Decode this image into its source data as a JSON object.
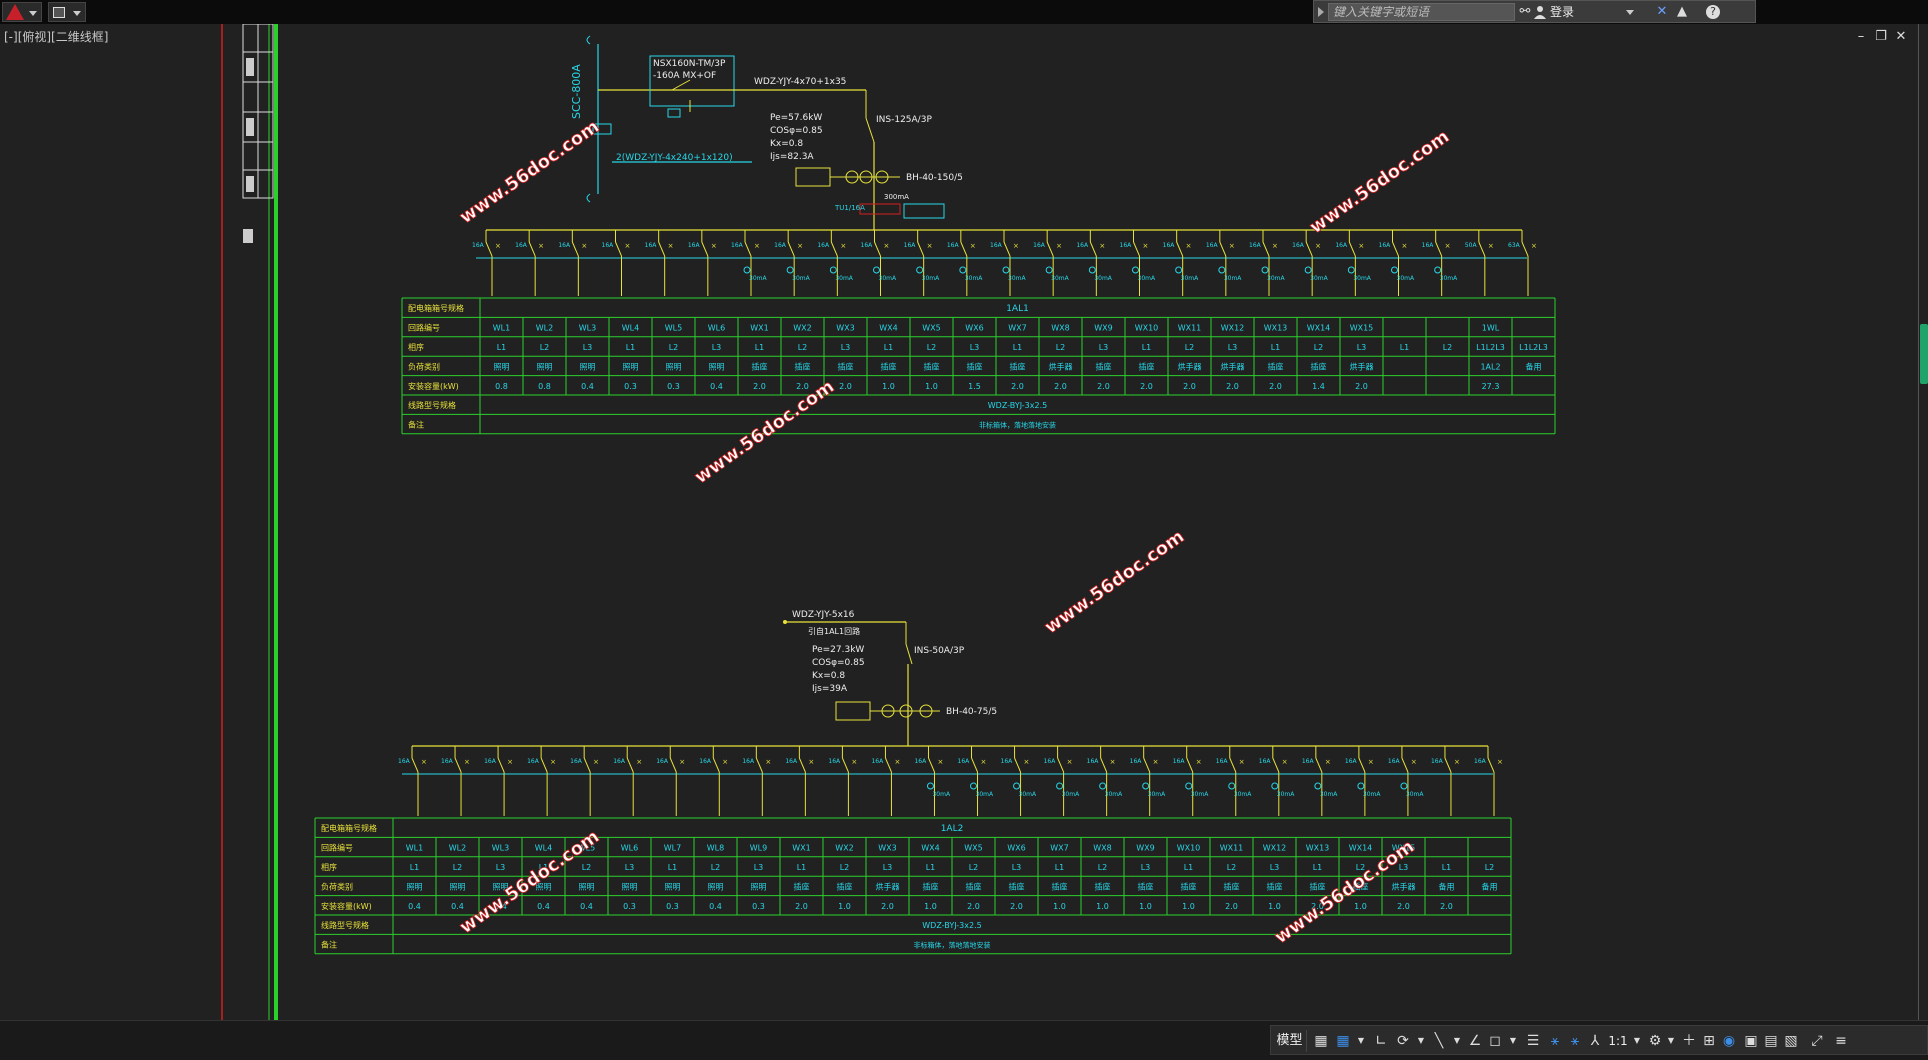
{
  "toolbar": {
    "app_menu_icon": "autocad-logo-icon",
    "quick_access_icon": "quick-access-icon"
  },
  "infocenter": {
    "search_placeholder": "键入关键字或短语",
    "login_label": "登录"
  },
  "viewport": {
    "label": "[-][俯视][二维线框]"
  },
  "watermark": "www.56doc.com",
  "panel1": {
    "incoming": {
      "breaker": "NSX160N-TM/3P",
      "breaker_rating": "-160A  MX+OF",
      "cable": "WDZ-YJY-4x70+1x35",
      "switch": "INS-125A/3P",
      "pe": "Pe=57.6kW",
      "cos": "COSφ=0.85",
      "kx": "Kx=0.8",
      "ij": "Ijs=82.3A",
      "ct": "BH-40-150/5",
      "feeder": "2(WDZ-YJY-4x240+1x120)",
      "busbar_label": "SCC-800A",
      "spd": "TU1/16A",
      "rcd": "300mA"
    },
    "header_label": "配电箱箱号规格",
    "panel_id": "1AL1",
    "row_labels": [
      "回路编号",
      "相序",
      "负荷类别",
      "安装容量(kW)",
      "线路型号规格",
      "备注"
    ],
    "circuits": [
      "WL1",
      "WL2",
      "WL3",
      "WL4",
      "WL5",
      "WL6",
      "WX1",
      "WX2",
      "WX3",
      "WX4",
      "WX5",
      "WX6",
      "WX7",
      "WX8",
      "WX9",
      "WX10",
      "WX11",
      "WX12",
      "WX13",
      "WX14",
      "WX15",
      "",
      "",
      "1WL",
      ""
    ],
    "phases": [
      "L1",
      "L2",
      "L3",
      "L1",
      "L2",
      "L3",
      "L1",
      "L2",
      "L3",
      "L1",
      "L2",
      "L3",
      "L1",
      "L2",
      "L3",
      "L1",
      "L2",
      "L3",
      "L1",
      "L2",
      "L3",
      "L1",
      "L2",
      "L1L2L3",
      "L1L2L3"
    ],
    "loads": [
      "照明",
      "照明",
      "照明",
      "照明",
      "照明",
      "照明",
      "插座",
      "插座",
      "插座",
      "插座",
      "插座",
      "插座",
      "插座",
      "烘手器",
      "插座",
      "插座",
      "烘手器",
      "烘手器",
      "插座",
      "插座",
      "烘手器",
      "",
      "",
      "1AL2",
      "备用"
    ],
    "capacity": [
      "0.8",
      "0.8",
      "0.4",
      "0.3",
      "0.3",
      "0.4",
      "2.0",
      "2.0",
      "2.0",
      "1.0",
      "1.0",
      "1.5",
      "2.0",
      "2.0",
      "2.0",
      "2.0",
      "2.0",
      "2.0",
      "2.0",
      "1.4",
      "2.0",
      "",
      "",
      "27.3",
      ""
    ],
    "cable_spec": "WDZ-BYJ-3x2.5",
    "remark": "非标箱体，落地落地安装",
    "breaker_ratings": [
      "16A",
      "16A",
      "16A",
      "16A",
      "16A",
      "16A",
      "16A",
      "16A",
      "16A",
      "16A",
      "16A",
      "16A",
      "16A",
      "16A",
      "16A",
      "16A",
      "16A",
      "16A",
      "16A",
      "16A",
      "16A",
      "16A",
      "16A",
      "50A",
      "63A"
    ],
    "rcd_label": "30mA"
  },
  "panel2": {
    "incoming": {
      "cable": "WDZ-YJY-5x16",
      "from": "引自1AL1回路",
      "switch": "INS-50A/3P",
      "pe": "Pe=27.3kW",
      "cos": "COSφ=0.85",
      "kx": "Kx=0.8",
      "ij": "Ijs=39A",
      "ct": "BH-40-75/5"
    },
    "header_label": "配电箱箱号规格",
    "panel_id": "1AL2",
    "row_labels": [
      "回路编号",
      "相序",
      "负荷类别",
      "安装容量(kW)",
      "线路型号规格",
      "备注"
    ],
    "circuits": [
      "WL1",
      "WL2",
      "WL3",
      "WL4",
      "WL5",
      "WL6",
      "WL7",
      "WL8",
      "WL9",
      "WX1",
      "WX2",
      "WX3",
      "WX4",
      "WX5",
      "WX6",
      "WX7",
      "WX8",
      "WX9",
      "WX10",
      "WX11",
      "WX12",
      "WX13",
      "WX14",
      "WX15",
      "",
      ""
    ],
    "phases": [
      "L1",
      "L2",
      "L3",
      "L1",
      "L2",
      "L3",
      "L1",
      "L2",
      "L3",
      "L1",
      "L2",
      "L3",
      "L1",
      "L2",
      "L3",
      "L1",
      "L2",
      "L3",
      "L1",
      "L2",
      "L3",
      "L1",
      "L2",
      "L3",
      "L1",
      "L2"
    ],
    "loads": [
      "照明",
      "照明",
      "照明",
      "照明",
      "照明",
      "照明",
      "照明",
      "照明",
      "照明",
      "插座",
      "插座",
      "烘手器",
      "插座",
      "插座",
      "插座",
      "插座",
      "插座",
      "插座",
      "插座",
      "插座",
      "插座",
      "插座",
      "插座",
      "烘手器",
      "备用",
      "备用"
    ],
    "capacity": [
      "0.4",
      "0.4",
      "0.4",
      "0.4",
      "0.4",
      "0.3",
      "0.3",
      "0.4",
      "0.3",
      "2.0",
      "1.0",
      "2.0",
      "1.0",
      "2.0",
      "2.0",
      "1.0",
      "1.0",
      "1.0",
      "1.0",
      "2.0",
      "1.0",
      "2.0",
      "1.0",
      "2.0",
      "2.0",
      ""
    ],
    "cable_spec": "WDZ-BYJ-3x2.5",
    "remark": "非标箱体，落地落地安装",
    "breaker_rating": "16A",
    "rcd_label": "30mA"
  },
  "statusbar": {
    "model_label": "模型",
    "scale": "1:1"
  },
  "colors": {
    "green": "#2bd12b",
    "cyan": "#27d7e8",
    "yellow": "#e8e23a",
    "red": "#d42020",
    "bg": "#212121"
  }
}
